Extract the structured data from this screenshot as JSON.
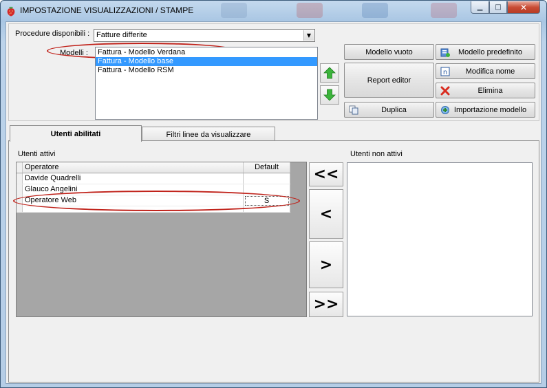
{
  "window": {
    "title": "IMPOSTAZIONE VISUALIZZAZIONI / STAMPE",
    "minimize_glyph": "▁",
    "maximize_glyph": "□",
    "close_glyph": "✕",
    "icon": "strawberry-icon"
  },
  "procedure": {
    "label": "Procedure disponibili :",
    "selected": "Fatture differite"
  },
  "models": {
    "label": "Modelli :",
    "items": [
      {
        "label": "Fattura - Modello Verdana",
        "selected": false
      },
      {
        "label": "Fattura - Modello base",
        "selected": true
      },
      {
        "label": "Fattura - Modello RSM",
        "selected": false
      }
    ]
  },
  "buttons": {
    "modello_vuoto": "Modello vuoto",
    "modello_predefinito": "Modello predefinito",
    "report_editor": "Report editor",
    "modifica_nome": "Modifica nome",
    "elimina": "Elimina",
    "duplica": "Duplica",
    "importazione_modello": "Importazione modello"
  },
  "tabs": [
    {
      "label": "Utenti abilitati",
      "active": true
    },
    {
      "label": "Filtri linee da visualizzare",
      "active": false
    }
  ],
  "users_panel": {
    "active_label": "Utenti attivi",
    "inactive_label": "Utenti non attivi",
    "columns": [
      "Operatore",
      "Default"
    ],
    "rows": [
      {
        "operatore": "Davide Quadrelli",
        "default": ""
      },
      {
        "operatore": "Glauco Angelini",
        "default": ""
      },
      {
        "operatore": "Operatore Web",
        "default": "S"
      }
    ],
    "move_buttons": {
      "all_left": "<<",
      "left": "<",
      "right": ">",
      "all_right": ">>"
    }
  },
  "colors": {
    "selection": "#3399ff",
    "highlight_oval": "#c0221a",
    "arrow_green": "#3cb43c"
  }
}
